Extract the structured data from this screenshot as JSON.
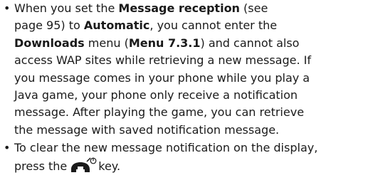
{
  "bullets": [
    "•",
    "•"
  ],
  "item1": {
    "l1_a": "When you set the ",
    "l1_b": "Message reception",
    "l1_c": " (see",
    "l2_a": "page 95) to ",
    "l2_b": "Automatic",
    "l2_c": ", you cannot enter the",
    "l3_a": "Downloads",
    "l3_b": " menu (",
    "l3_c": "Menu 7.3.1",
    "l3_d": ") and cannot also",
    "l4": "access WAP sites while retrieving a new message. If",
    "l5": "you message comes in your phone while you play a",
    "l6": "Java game, your phone only receive a notification",
    "l7": "message. After playing the game, you can retrieve",
    "l8": "the message with saved notification message."
  },
  "item2": {
    "l1": "To clear the new message notification on the display,",
    "l2_a": "press the",
    "l2_b": "key."
  },
  "icons": {
    "key": "end-power-key-icon"
  }
}
